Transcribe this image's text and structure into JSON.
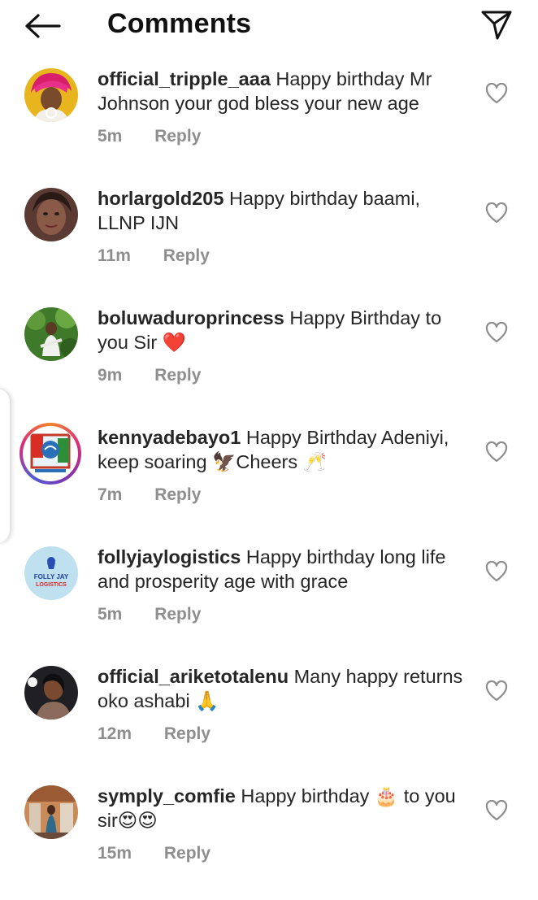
{
  "header": {
    "title": "Comments"
  },
  "comments": [
    {
      "username": "official_tripple_aaa",
      "text": "Happy birthday Mr Johnson your god bless your new age",
      "time": "5m",
      "reply_label": "Reply"
    },
    {
      "username": "horlargold205",
      "text": "Happy birthday baami, LLNP IJN",
      "time": "11m",
      "reply_label": "Reply"
    },
    {
      "username": "boluwaduroprincess",
      "text": "Happy Birthday to you Sir ❤️",
      "time": "9m",
      "reply_label": "Reply"
    },
    {
      "username": "kennyadebayo1",
      "text": "Happy Birthday Adeniyi, keep soaring 🦅Cheers 🥂",
      "time": "7m",
      "reply_label": "Reply"
    },
    {
      "username": "follyjaylogistics",
      "text": "Happy birthday long life and prosperity age with grace",
      "time": "5m",
      "reply_label": "Reply"
    },
    {
      "username": "official_ariketotalenu",
      "text": "Many happy returns oko ashabi 🙏",
      "time": "12m",
      "reply_label": "Reply"
    },
    {
      "username": "symply_comfie",
      "text": "Happy birthday 🎂 to you sir😍😍",
      "time": "15m",
      "reply_label": "Reply"
    }
  ],
  "avatar_logo_text": {
    "follyjay": [
      "FOLLY JAY",
      "LOGISTICS"
    ]
  },
  "icons": {
    "back": "arrow-left-icon",
    "send": "paper-plane-icon",
    "like": "heart-outline-icon"
  },
  "colors": {
    "text": "#262626",
    "meta": "#8e8e8e",
    "heart_outline": "#8e8e8e"
  }
}
